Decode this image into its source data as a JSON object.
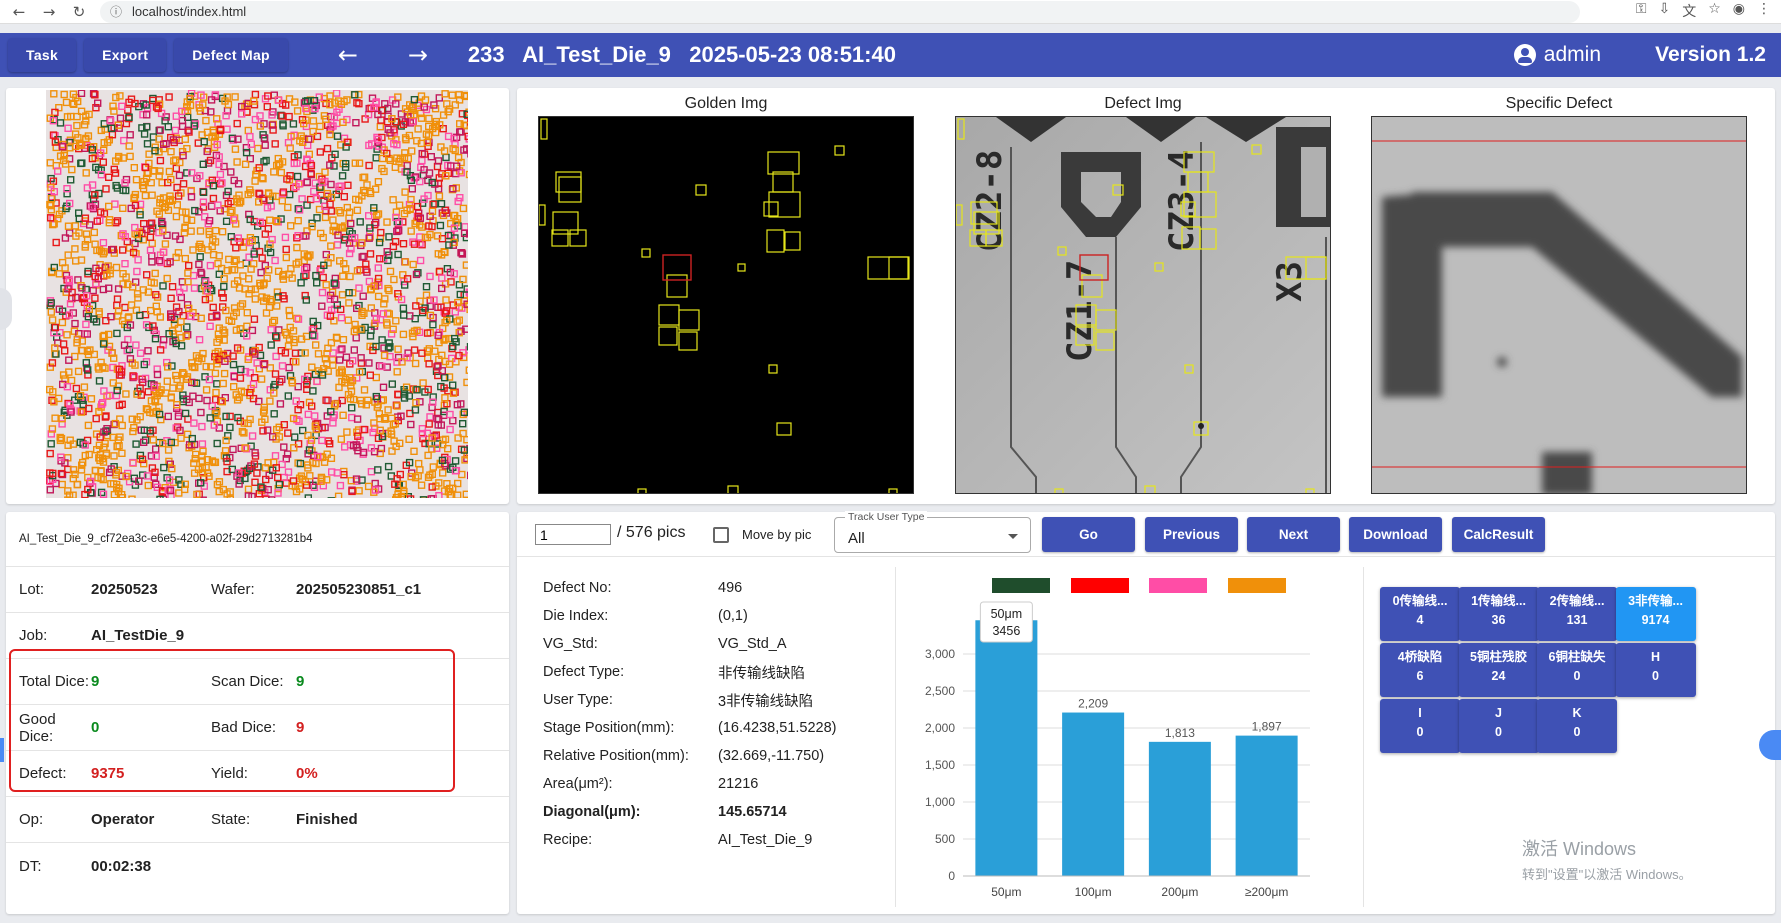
{
  "browser": {
    "url": "localhost/index.html"
  },
  "appbar": {
    "task_label": "Task",
    "export_label": "Export",
    "defect_map_label": "Defect Map",
    "title": "233   AI_Test_Die_9   2025-05-23 08:51:40",
    "user": "admin",
    "version": "Version 1.2"
  },
  "images": {
    "golden_title": "Golden Img",
    "defect_title": "Defect Img",
    "specific_title": "Specific Defect",
    "defect_marks": [
      "CZ2-8",
      "CZ3-4",
      "CZ1-7",
      "X3"
    ]
  },
  "info": {
    "id": "AI_Test_Die_9_cf72ea3c-e6e5-4200-a02f-29d2713281b4",
    "rows": [
      {
        "k1": "Lot:",
        "v1": "20250523",
        "k2": "Wafer:",
        "v2": "202505230851_c1"
      },
      {
        "k1": "Job:",
        "v1": "AI_TestDie_9",
        "k2": "",
        "v2": ""
      },
      {
        "k1": "Total Dice:",
        "v1": "9",
        "k2": "Scan Dice:",
        "v2": "9"
      },
      {
        "k1": "Good Dice:",
        "v1": "0",
        "k2": "Bad Dice:",
        "v2": "9"
      },
      {
        "k1": "Defect:",
        "v1": "9375",
        "k2": "Yield:",
        "v2": "0%"
      },
      {
        "k1": "Op:",
        "v1": "Operator",
        "k2": "State:",
        "v2": "Finished"
      },
      {
        "k1": "DT:",
        "v1": "00:02:38",
        "k2": "",
        "v2": ""
      }
    ]
  },
  "controls": {
    "page_value": "1",
    "page_total": "/ 576 pics",
    "move_by_pic": "Move by pic",
    "track_label": "Track User Type",
    "track_value": "All",
    "go": "Go",
    "previous": "Previous",
    "next": "Next",
    "download": "Download",
    "calc": "CalcResult"
  },
  "detail": [
    {
      "k": "Defect No:",
      "v": "496"
    },
    {
      "k": "Die Index:",
      "v": "(0,1)"
    },
    {
      "k": "VG_Std:",
      "v": "VG_Std_A"
    },
    {
      "k": "Defect Type:",
      "v": "非传输线缺陷"
    },
    {
      "k": "User Type:",
      "v": "3非传输线缺陷"
    },
    {
      "k": "Stage Position(mm):",
      "v": "(16.4238,51.5228)"
    },
    {
      "k": "Relative Position(mm):",
      "v": "(32.669,-11.750)"
    },
    {
      "k": "Area(μm²):",
      "v": "21216"
    },
    {
      "k": "Diagonal(μm):",
      "v": "145.65714"
    },
    {
      "k": "Recipe:",
      "v": "AI_Test_Die_9"
    }
  ],
  "chart_data": {
    "type": "bar",
    "categories": [
      "50μm",
      "100μm",
      "200μm",
      "≥200μm"
    ],
    "values": [
      3456,
      2209,
      1813,
      1897
    ],
    "value_labels": [
      "",
      "2,209",
      "1,813",
      "1,897"
    ],
    "ylim": [
      0,
      3000
    ],
    "yticks": [
      "0",
      "500",
      "1,000",
      "1,500",
      "2,000",
      "2,500",
      "3,000"
    ],
    "tooltip": {
      "category": "50μm",
      "value": "3456"
    },
    "bar_color": "#2a9fd8",
    "legend_colors": [
      "#1f4d2c",
      "#ff0000",
      "#ff4da6",
      "#f0900a"
    ]
  },
  "defect_buttons": [
    {
      "label": "0传输线...",
      "count": "4",
      "active": false
    },
    {
      "label": "1传输线...",
      "count": "36",
      "active": false
    },
    {
      "label": "2传输线...",
      "count": "131",
      "active": false
    },
    {
      "label": "3非传输...",
      "count": "9174",
      "active": true
    },
    {
      "label": "4桥缺陷",
      "count": "6",
      "active": false
    },
    {
      "label": "5铜柱残胶",
      "count": "24",
      "active": false
    },
    {
      "label": "6铜柱缺失",
      "count": "0",
      "active": false
    },
    {
      "label": "H",
      "count": "0",
      "active": false
    },
    {
      "label": "I",
      "count": "0",
      "active": false
    },
    {
      "label": "J",
      "count": "0",
      "active": false
    },
    {
      "label": "K",
      "count": "0",
      "active": false
    }
  ],
  "watermark": {
    "line1": "激活 Windows",
    "line2": "转到\"设置\"以激活 Windows。"
  }
}
